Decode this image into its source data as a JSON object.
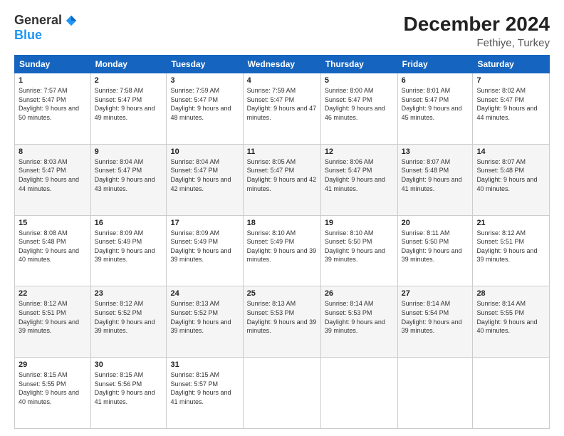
{
  "logo": {
    "general": "General",
    "blue": "Blue"
  },
  "header": {
    "title": "December 2024",
    "subtitle": "Fethiye, Turkey"
  },
  "days_of_week": [
    "Sunday",
    "Monday",
    "Tuesday",
    "Wednesday",
    "Thursday",
    "Friday",
    "Saturday"
  ],
  "weeks": [
    [
      {
        "day": "1",
        "sunrise": "7:57 AM",
        "sunset": "5:47 PM",
        "daylight": "9 hours and 50 minutes."
      },
      {
        "day": "2",
        "sunrise": "7:58 AM",
        "sunset": "5:47 PM",
        "daylight": "9 hours and 49 minutes."
      },
      {
        "day": "3",
        "sunrise": "7:59 AM",
        "sunset": "5:47 PM",
        "daylight": "9 hours and 48 minutes."
      },
      {
        "day": "4",
        "sunrise": "7:59 AM",
        "sunset": "5:47 PM",
        "daylight": "9 hours and 47 minutes."
      },
      {
        "day": "5",
        "sunrise": "8:00 AM",
        "sunset": "5:47 PM",
        "daylight": "9 hours and 46 minutes."
      },
      {
        "day": "6",
        "sunrise": "8:01 AM",
        "sunset": "5:47 PM",
        "daylight": "9 hours and 45 minutes."
      },
      {
        "day": "7",
        "sunrise": "8:02 AM",
        "sunset": "5:47 PM",
        "daylight": "9 hours and 44 minutes."
      }
    ],
    [
      {
        "day": "8",
        "sunrise": "8:03 AM",
        "sunset": "5:47 PM",
        "daylight": "9 hours and 44 minutes."
      },
      {
        "day": "9",
        "sunrise": "8:04 AM",
        "sunset": "5:47 PM",
        "daylight": "9 hours and 43 minutes."
      },
      {
        "day": "10",
        "sunrise": "8:04 AM",
        "sunset": "5:47 PM",
        "daylight": "9 hours and 42 minutes."
      },
      {
        "day": "11",
        "sunrise": "8:05 AM",
        "sunset": "5:47 PM",
        "daylight": "9 hours and 42 minutes."
      },
      {
        "day": "12",
        "sunrise": "8:06 AM",
        "sunset": "5:47 PM",
        "daylight": "9 hours and 41 minutes."
      },
      {
        "day": "13",
        "sunrise": "8:07 AM",
        "sunset": "5:48 PM",
        "daylight": "9 hours and 41 minutes."
      },
      {
        "day": "14",
        "sunrise": "8:07 AM",
        "sunset": "5:48 PM",
        "daylight": "9 hours and 40 minutes."
      }
    ],
    [
      {
        "day": "15",
        "sunrise": "8:08 AM",
        "sunset": "5:48 PM",
        "daylight": "9 hours and 40 minutes."
      },
      {
        "day": "16",
        "sunrise": "8:09 AM",
        "sunset": "5:49 PM",
        "daylight": "9 hours and 39 minutes."
      },
      {
        "day": "17",
        "sunrise": "8:09 AM",
        "sunset": "5:49 PM",
        "daylight": "9 hours and 39 minutes."
      },
      {
        "day": "18",
        "sunrise": "8:10 AM",
        "sunset": "5:49 PM",
        "daylight": "9 hours and 39 minutes."
      },
      {
        "day": "19",
        "sunrise": "8:10 AM",
        "sunset": "5:50 PM",
        "daylight": "9 hours and 39 minutes."
      },
      {
        "day": "20",
        "sunrise": "8:11 AM",
        "sunset": "5:50 PM",
        "daylight": "9 hours and 39 minutes."
      },
      {
        "day": "21",
        "sunrise": "8:12 AM",
        "sunset": "5:51 PM",
        "daylight": "9 hours and 39 minutes."
      }
    ],
    [
      {
        "day": "22",
        "sunrise": "8:12 AM",
        "sunset": "5:51 PM",
        "daylight": "9 hours and 39 minutes."
      },
      {
        "day": "23",
        "sunrise": "8:12 AM",
        "sunset": "5:52 PM",
        "daylight": "9 hours and 39 minutes."
      },
      {
        "day": "24",
        "sunrise": "8:13 AM",
        "sunset": "5:52 PM",
        "daylight": "9 hours and 39 minutes."
      },
      {
        "day": "25",
        "sunrise": "8:13 AM",
        "sunset": "5:53 PM",
        "daylight": "9 hours and 39 minutes."
      },
      {
        "day": "26",
        "sunrise": "8:14 AM",
        "sunset": "5:53 PM",
        "daylight": "9 hours and 39 minutes."
      },
      {
        "day": "27",
        "sunrise": "8:14 AM",
        "sunset": "5:54 PM",
        "daylight": "9 hours and 39 minutes."
      },
      {
        "day": "28",
        "sunrise": "8:14 AM",
        "sunset": "5:55 PM",
        "daylight": "9 hours and 40 minutes."
      }
    ],
    [
      {
        "day": "29",
        "sunrise": "8:15 AM",
        "sunset": "5:55 PM",
        "daylight": "9 hours and 40 minutes."
      },
      {
        "day": "30",
        "sunrise": "8:15 AM",
        "sunset": "5:56 PM",
        "daylight": "9 hours and 41 minutes."
      },
      {
        "day": "31",
        "sunrise": "8:15 AM",
        "sunset": "5:57 PM",
        "daylight": "9 hours and 41 minutes."
      },
      null,
      null,
      null,
      null
    ]
  ],
  "labels": {
    "sunrise": "Sunrise:",
    "sunset": "Sunset:",
    "daylight": "Daylight:"
  }
}
